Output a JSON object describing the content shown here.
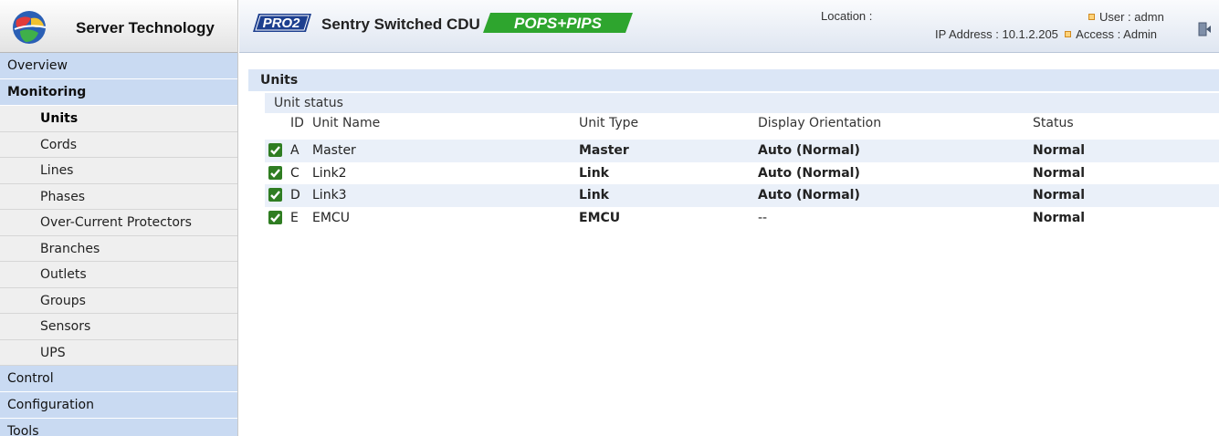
{
  "brand": {
    "name": "Server Technology"
  },
  "header": {
    "product_badge": "PRO2",
    "product_title": "Sentry Switched CDU",
    "feature_badge": "POPS+PIPS",
    "location": "Location :",
    "ip_address": "IP Address : 10.1.2.205",
    "user": "User : admn",
    "access": "Access : Admin"
  },
  "sidebar": {
    "items": [
      {
        "label": "Overview"
      },
      {
        "label": "Monitoring"
      },
      {
        "label": "Control"
      },
      {
        "label": "Configuration"
      },
      {
        "label": "Tools"
      }
    ],
    "subitems": [
      {
        "label": "Units"
      },
      {
        "label": "Cords"
      },
      {
        "label": "Lines"
      },
      {
        "label": "Phases"
      },
      {
        "label": "Over-Current Protectors"
      },
      {
        "label": "Branches"
      },
      {
        "label": "Outlets"
      },
      {
        "label": "Groups"
      },
      {
        "label": "Sensors"
      },
      {
        "label": "UPS"
      }
    ]
  },
  "main": {
    "section_title": "Units",
    "subsection_title": "Unit status",
    "columns": [
      "ID",
      "Unit Name",
      "Unit Type",
      "Display Orientation",
      "Status"
    ],
    "rows": [
      {
        "id": "A",
        "name": "Master",
        "type": "Master",
        "orientation": "Auto (Normal)",
        "status": "Normal"
      },
      {
        "id": "C",
        "name": "Link2",
        "type": "Link",
        "orientation": "Auto (Normal)",
        "status": "Normal"
      },
      {
        "id": "D",
        "name": "Link3",
        "type": "Link",
        "orientation": "Auto (Normal)",
        "status": "Normal"
      },
      {
        "id": "E",
        "name": "EMCU",
        "type": "EMCU",
        "orientation": "--",
        "status": "Normal"
      }
    ]
  },
  "colors": {
    "accent": "#c9daf2",
    "status_ok": "#1fa31f",
    "checkbox": "#2f7d22"
  },
  "icons": {
    "logo": "globe-logo-icon",
    "checkbox": "checkbox-checked-icon",
    "logout": "logout-icon"
  }
}
